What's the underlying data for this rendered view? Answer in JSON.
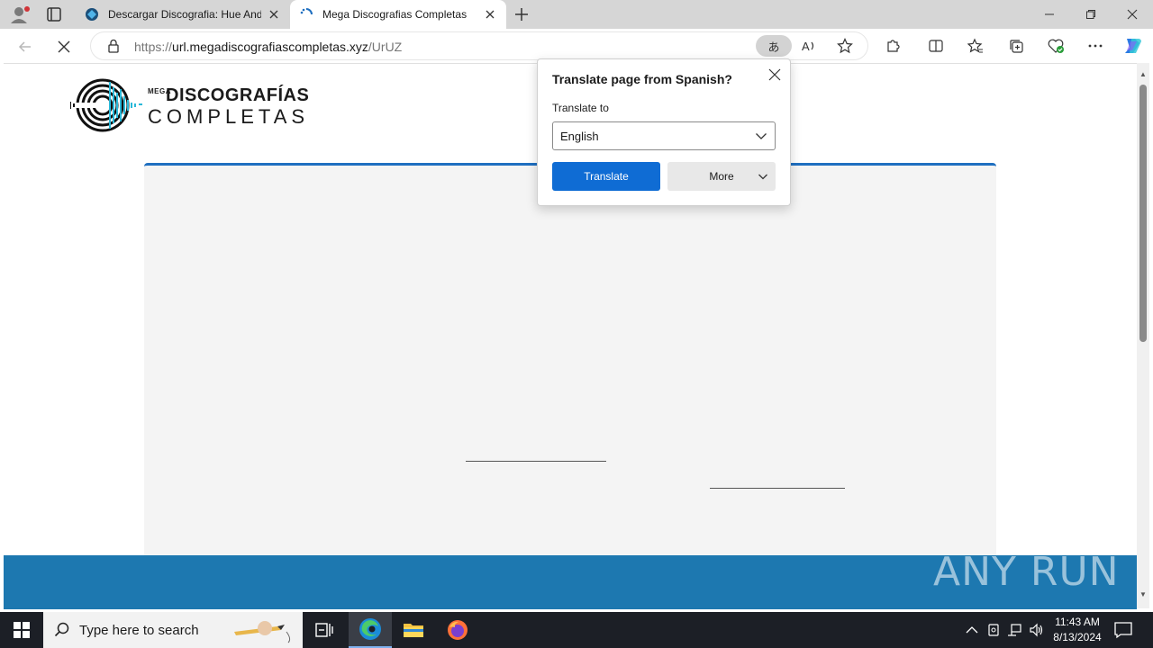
{
  "browser": {
    "tabs": [
      {
        "title": "Descargar Discografia: Hue And Cry",
        "active": false
      },
      {
        "title": "Mega Discografias Completas",
        "active": true
      }
    ],
    "url": {
      "scheme": "https://",
      "host": "url.megadiscografiascompletas.xyz",
      "path": "/UrUZ"
    },
    "translate_pill_glyph": "あ"
  },
  "logo": {
    "mega": "MEGA",
    "title_line1": "DISCOGRAFÍAS",
    "title_line2": "COMPLETAS"
  },
  "translate_popup": {
    "title": "Translate page from Spanish?",
    "label": "Translate to",
    "selected_language": "English",
    "translate_button": "Translate",
    "more_button": "More"
  },
  "watermark": "ANY RUN",
  "taskbar": {
    "search_placeholder": "Type here to search",
    "time": "11:43 AM",
    "date": "8/13/2024"
  },
  "colors": {
    "accent_blue": "#0f6cd4",
    "footer_blue": "#1d78b0",
    "panel_border": "#1f6fc0",
    "tabbar": "#d6d6d6",
    "taskbar": "#1c1f26"
  }
}
